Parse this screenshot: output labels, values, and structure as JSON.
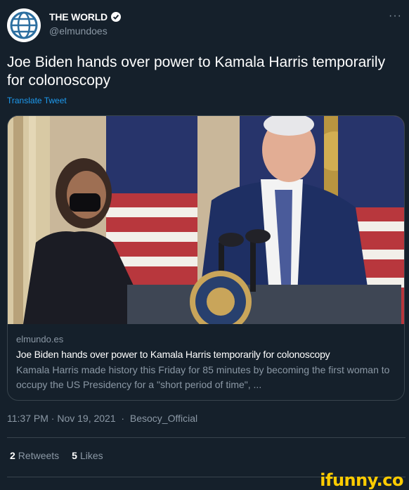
{
  "tweet": {
    "account": {
      "display_name": "THE WORLD",
      "handle": "@elmundoes",
      "verified": true,
      "avatar_icon": "globe-icon"
    },
    "text": "Joe Biden hands over power to Kamala Harris temporarily for colonoscopy",
    "translate_label": "Translate Tweet",
    "card": {
      "domain": "elmundo.es",
      "title": "Joe Biden hands over power to Kamala Harris temporarily for colonoscopy",
      "description": "Kamala Harris made history this Friday for 85 minutes by becoming the first woman to occupy the US Presidency for a \"short period of time\", ..."
    },
    "time": "11:37 PM",
    "date": "Nov 19, 2021",
    "source": "Besocy_Official",
    "stats": {
      "retweets_count": "2",
      "retweets_label": "Retweets",
      "likes_count": "5",
      "likes_label": "Likes"
    }
  },
  "watermark": "ifunny.co",
  "colors": {
    "background": "#15202b",
    "link": "#1d9bf0",
    "muted": "#8b98a5",
    "border": "#38444d",
    "watermark": "#ffcc00"
  }
}
